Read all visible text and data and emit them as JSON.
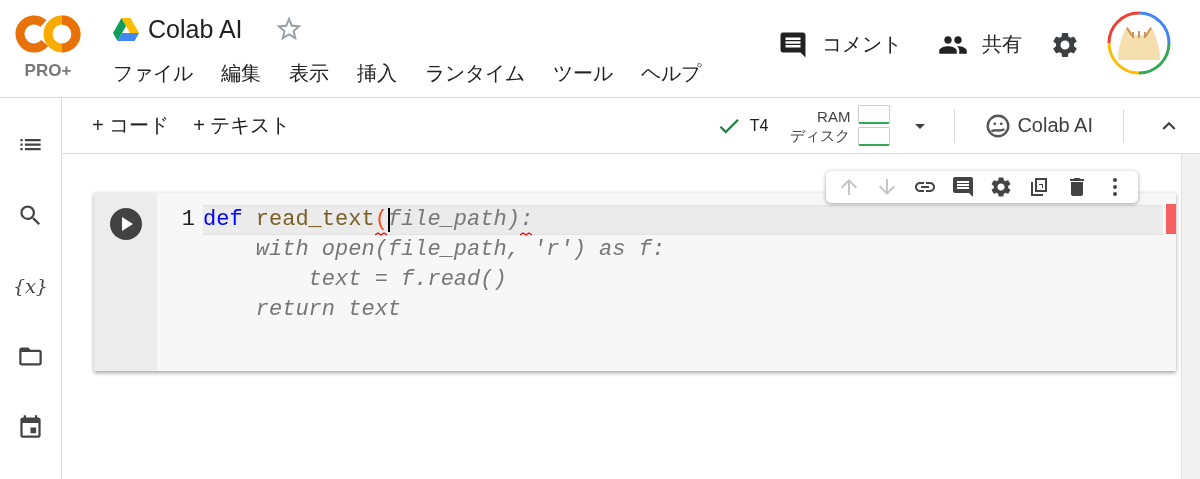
{
  "header": {
    "logo_badge": "PRO+",
    "title": "Colab AI",
    "starred": false,
    "menu": [
      "ファイル",
      "編集",
      "表示",
      "挿入",
      "ランタイム",
      "ツール",
      "ヘルプ"
    ],
    "actions": [
      {
        "kind": "comment",
        "label": "コメント"
      },
      {
        "kind": "share",
        "label": "共有"
      }
    ]
  },
  "sidebar": [
    {
      "kind": "toc"
    },
    {
      "kind": "search"
    },
    {
      "kind": "variables",
      "glyph": "{x}"
    },
    {
      "kind": "files"
    },
    {
      "kind": "calendar"
    }
  ],
  "toolbar": {
    "add_buttons": [
      "+ コード",
      "+ テキスト"
    ],
    "runtime": {
      "connected": true,
      "label": "T4",
      "meters": [
        {
          "label": "RAM"
        },
        {
          "label": "ディスク"
        }
      ]
    },
    "ai_button": "Colab AI"
  },
  "cell": {
    "toolbar": [
      {
        "kind": "up",
        "disabled": true
      },
      {
        "kind": "down",
        "disabled": true
      },
      {
        "kind": "link",
        "disabled": false
      },
      {
        "kind": "comment",
        "disabled": false
      },
      {
        "kind": "settings",
        "disabled": false
      },
      {
        "kind": "mirror",
        "disabled": false
      },
      {
        "kind": "delete",
        "disabled": false
      },
      {
        "kind": "more",
        "disabled": false
      }
    ],
    "lines": [
      {
        "number": "1",
        "active": true,
        "tokens": [
          {
            "text": "def ",
            "kind": "keyword"
          },
          {
            "text": "read_text",
            "kind": "function"
          },
          {
            "text": "(",
            "kind": "unmatched",
            "flagged": true,
            "cursor": true
          },
          {
            "text": "file_path)",
            "kind": "suggestion"
          },
          {
            "text": ":",
            "kind": "suggestion",
            "flagged": true
          }
        ]
      },
      {
        "active": false,
        "tokens": [
          {
            "text": "    with open(file_path, 'r') as f:",
            "kind": "suggestion"
          }
        ]
      },
      {
        "active": false,
        "tokens": [
          {
            "text": "        text = f.read()",
            "kind": "suggestion"
          }
        ]
      },
      {
        "active": false,
        "tokens": [
          {
            "text": "    return text",
            "kind": "suggestion"
          }
        ]
      }
    ]
  }
}
